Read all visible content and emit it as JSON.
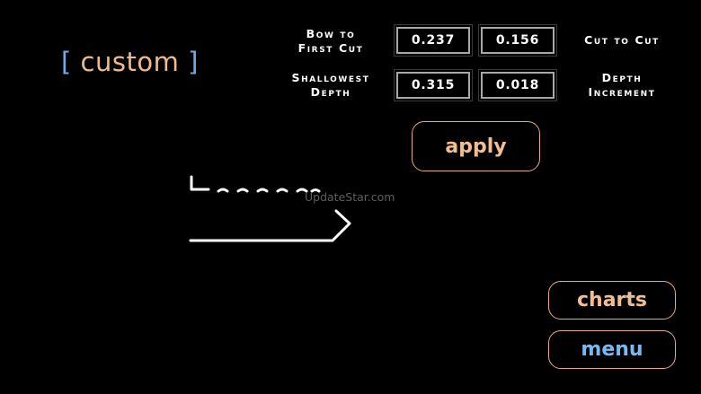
{
  "header": {
    "bracket_open": "[",
    "title": "custom",
    "bracket_close": "]"
  },
  "params": {
    "bow_to_first_cut": {
      "label_line1": "Bow to",
      "label_line2": "First Cut",
      "value": "0.237"
    },
    "cut_to_cut": {
      "label": "Cut to Cut",
      "value": "0.156"
    },
    "shallowest_depth": {
      "label_line1": "Shallowest",
      "label_line2": "Depth",
      "value": "0.315"
    },
    "depth_increment": {
      "label_line1": "Depth",
      "label_line2": "Increment",
      "value": "0.018"
    }
  },
  "buttons": {
    "apply": "apply",
    "charts": "charts",
    "menu": "menu"
  },
  "watermark": "UpdateStar.com",
  "colors": {
    "title_text": "#f2b98a",
    "bracket": "#6aaee8",
    "button_border": "#e8ac78",
    "menu_text": "#7ab8f0"
  }
}
